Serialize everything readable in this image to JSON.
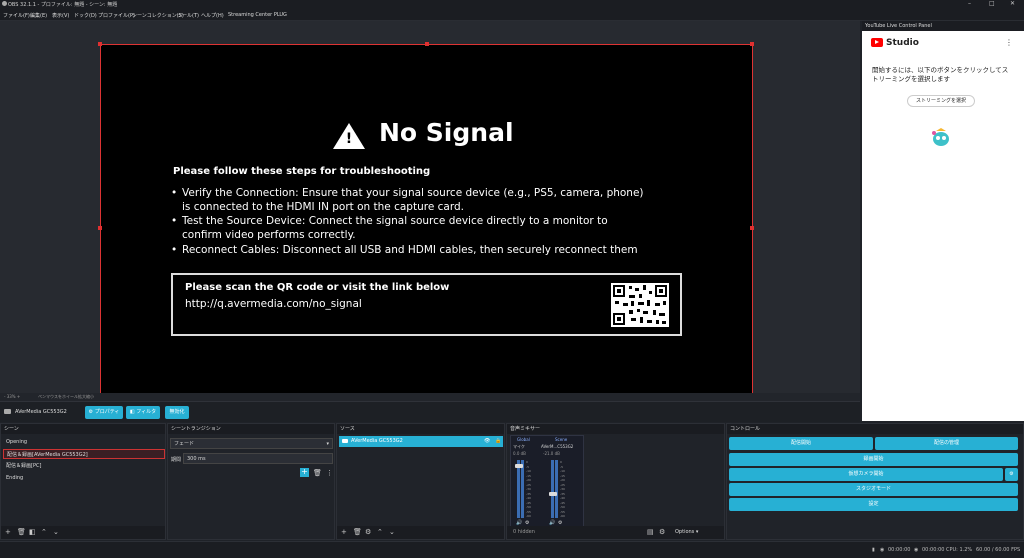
{
  "window": {
    "title": "OBS 32.1.1 - プロファイル: 無題 - シーン: 無題",
    "controls": [
      "–",
      "□",
      "✕"
    ]
  },
  "menu": {
    "items": [
      "ファイル(F)",
      "編集(E)",
      "表示(V)",
      "ドック(D)",
      "プロファイル(P)",
      "シーンコレクション(S)",
      "ツール(T)",
      "ヘルプ(H)",
      "Streaming Center PLUG"
    ]
  },
  "preview": {
    "heading": "No Signal",
    "steps_title": "Please follow these steps for troubleshooting",
    "bullets": [
      {
        "lines": [
          "Verify the Connection: Ensure that your signal source device (e.g., PS5, camera, phone)",
          "is connected to the HDMI IN port on the capture card."
        ]
      },
      {
        "lines": [
          "Test the Source Device: Connect the signal source device directly to a monitor to",
          "confirm video performs correctly."
        ]
      },
      {
        "lines": [
          "Reconnect Cables: Disconnect all USB and HDMI cables, then securely reconnect them"
        ]
      }
    ],
    "qr_heading": "Please scan the QR code or visit the link below",
    "qr_link": "http://q.avermedia.com/no_signal"
  },
  "zoombar": {
    "zoom": "- 33% +",
    "hint": "ペンマウスをホイール拡大縮小"
  },
  "source_toolbar": {
    "source_name": "AVerMedia GC553G2",
    "properties": "プロパティ",
    "filters": "フィルタ",
    "deactivate": "無効化"
  },
  "scenes": {
    "title": "シーン",
    "items": [
      "Opening",
      "配信＆録画[AVerMedia GC553G2]",
      "配信＆録画[PC]",
      "Ending"
    ],
    "selected_index": 1
  },
  "transitions": {
    "title": "シーントランジション",
    "type": "フェード",
    "duration_label": "期間",
    "duration": "300 ms"
  },
  "sources": {
    "title": "ソース",
    "items": [
      "AVerMedia GC553G2"
    ]
  },
  "mixer": {
    "title": "音声ミキサー",
    "global_label": "Global",
    "scene_label": "Scene",
    "ch1_name": "マイク",
    "ch2_name": "AVerM...C553G2",
    "ch1_db": "0.0 dB",
    "ch2_db": "-21.0 dB",
    "ticks": [
      "0",
      "-5",
      "-10",
      "-15",
      "-20",
      "-25",
      "-30",
      "-35",
      "-40",
      "-45",
      "-50",
      "-55",
      "-60"
    ],
    "hidden_count": "0 hidden",
    "options": "Options"
  },
  "controls": {
    "title": "コントロール",
    "start_stream": "配信開始",
    "manage_stream": "配信の管理",
    "start_record": "録画開始",
    "start_virtualcam": "仮想カメラ開始",
    "studio_mode": "スタジオモード",
    "settings": "設定"
  },
  "youtube": {
    "panel_title": "YouTube Live Control Panel",
    "brand": "Studio",
    "message": "開始するには、以下のボタンをクリックしてストリーミングを選択します",
    "button": "ストリーミングを選択"
  },
  "status": {
    "rec_time": "00:00:00",
    "stream_time": "00:00:00",
    "cpu": "CPU: 1.2%",
    "fps": "60.00 / 60.00 FPS"
  }
}
